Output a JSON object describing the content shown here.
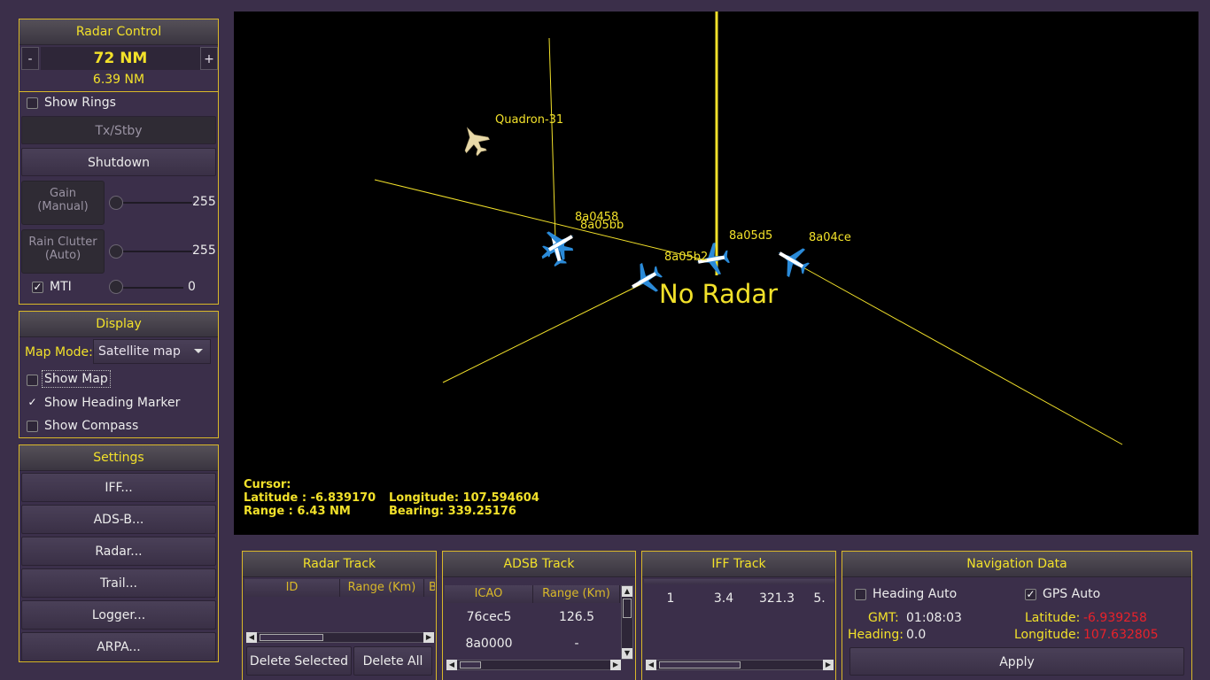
{
  "radar_control": {
    "title": "Radar Control",
    "minus_label": "-",
    "plus_label": "+",
    "range": "72 NM",
    "ring_range": "6.39 NM",
    "show_rings": "Show Rings",
    "tx_stby": "Tx/Stby",
    "shutdown": "Shutdown",
    "gain_label": "Gain\n(Manual)",
    "gain_value": "255",
    "gain_level": 0,
    "rain_label": "Rain Clutter\n(Auto)",
    "rain_value": "255",
    "rain_level": 0,
    "mti_label": "MTI",
    "mti_value": "0",
    "mti_checked": true
  },
  "display": {
    "title": "Display",
    "map_mode_label": "Map Mode:",
    "map_mode_value": "Satellite map",
    "show_map": "Show Map",
    "show_heading_marker": "Show Heading Marker",
    "show_compass": "Show Compass",
    "heading_marker_checked": true
  },
  "settings": {
    "title": "Settings",
    "buttons": [
      "IFF...",
      "ADS-B...",
      "Radar...",
      "Trail...",
      "Logger...",
      "ARPA..."
    ]
  },
  "radar_view": {
    "status": "No Radar",
    "targets": [
      "Quadron-31",
      "8a0458",
      "8a05bb",
      "8a05d5",
      "8a05b2",
      "8a04ce"
    ],
    "cursor": {
      "title": "Cursor:",
      "latitude": "Latitude : -6.839170",
      "longitude": "Longitude: 107.594604",
      "range": "Range : 6.43 NM",
      "bearing": "Bearing: 339.25176"
    }
  },
  "radar_track": {
    "title": "Radar Track",
    "columns": [
      "ID",
      "Range (Km)",
      "B"
    ],
    "delete_selected": "Delete Selected",
    "delete_all": "Delete All"
  },
  "adsb_track": {
    "title": "ADSB Track",
    "columns": [
      "ICAO",
      "Range (Km)"
    ],
    "rows": [
      [
        "76cec5",
        "126.5"
      ],
      [
        "8a0000",
        "-"
      ]
    ]
  },
  "iff_track": {
    "title": "IFF Track",
    "row": [
      "1",
      "3.4",
      "321.3",
      "5."
    ]
  },
  "navigation": {
    "title": "Navigation Data",
    "heading_auto": "Heading Auto",
    "gps_auto": "GPS Auto",
    "gps_checked": true,
    "gmt_label": "GMT:",
    "gmt_value": "01:08:03",
    "heading_label": "Heading:",
    "heading_value": "0.0",
    "latitude_label": "Latitude:",
    "latitude_value": "-6.939258",
    "longitude_label": "Longitude:",
    "longitude_value": "107.632805",
    "apply": "Apply",
    "alert_color": "#e8222b"
  },
  "colors": {
    "accent": "#f2e12a",
    "border": "#d9b829",
    "background": "#3b2f4a"
  }
}
